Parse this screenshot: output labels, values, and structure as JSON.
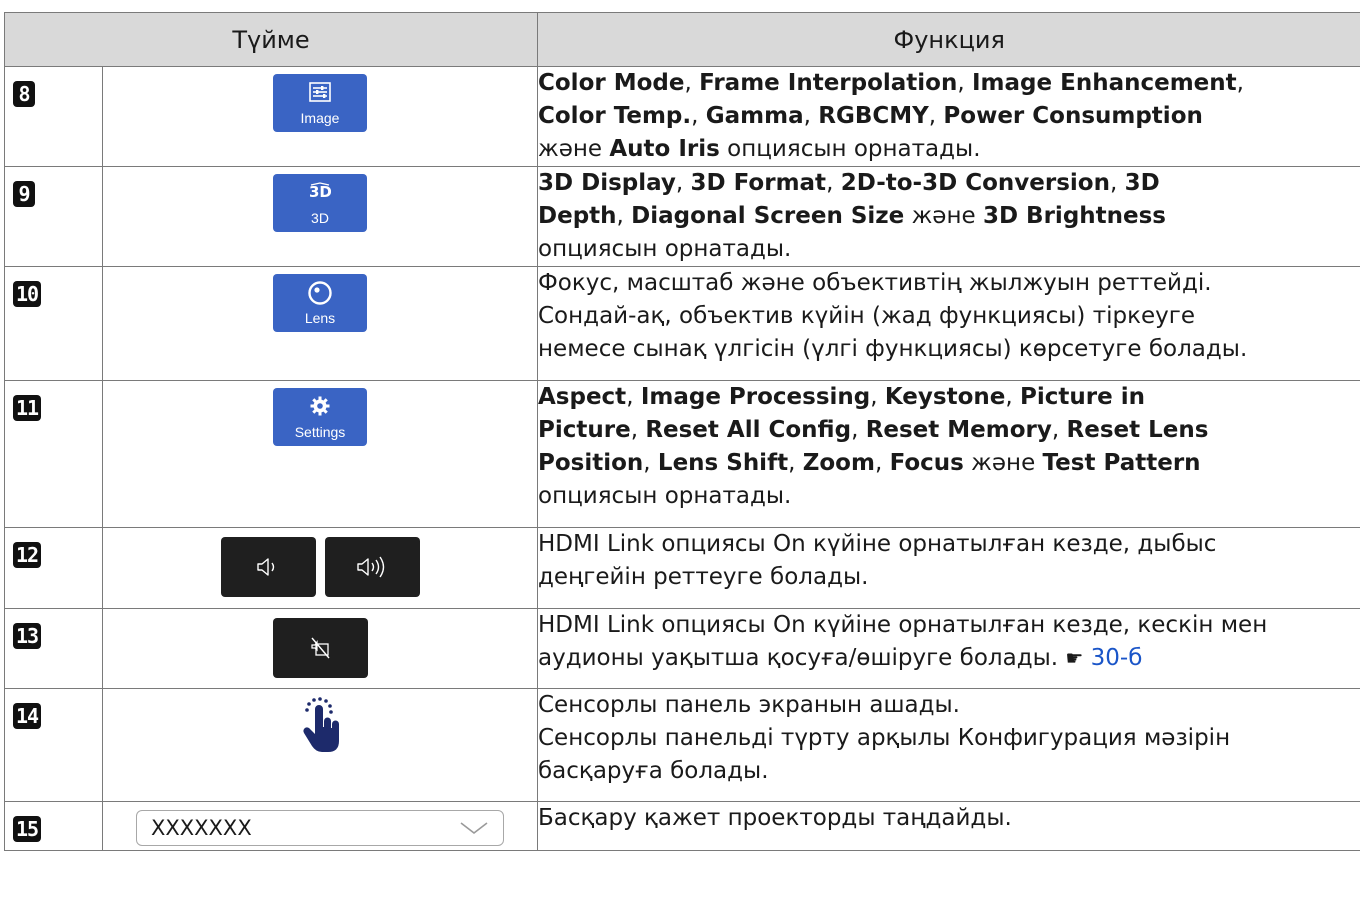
{
  "header": {
    "col_button": "Түйме",
    "col_function": "Функция"
  },
  "rows": [
    {
      "num": "8",
      "button": {
        "caption": "Image",
        "icon": "sliders-icon"
      },
      "lines": [
        [
          {
            "t": "Color Mode",
            "b": true
          },
          {
            "t": ", "
          },
          {
            "t": "Frame Interpolation",
            "b": true
          },
          {
            "t": ", "
          },
          {
            "t": "Image Enhancement",
            "b": true
          },
          {
            "t": ","
          }
        ],
        [
          {
            "t": "Color Temp.",
            "b": true
          },
          {
            "t": ", "
          },
          {
            "t": "Gamma",
            "b": true
          },
          {
            "t": ", "
          },
          {
            "t": "RGBCMY",
            "b": true
          },
          {
            "t": ", "
          },
          {
            "t": "Power Consumption",
            "b": true
          }
        ],
        [
          {
            "t": "және "
          },
          {
            "t": "Auto Iris",
            "b": true
          },
          {
            "t": " опциясын орнатады."
          }
        ]
      ]
    },
    {
      "num": "9",
      "button": {
        "caption": "3D",
        "icon": "3d-icon"
      },
      "lines": [
        [
          {
            "t": "3D Display",
            "b": true
          },
          {
            "t": ", "
          },
          {
            "t": "3D Format",
            "b": true
          },
          {
            "t": ", "
          },
          {
            "t": "2D-to-3D Conversion",
            "b": true
          },
          {
            "t": ", "
          },
          {
            "t": "3D",
            "b": true
          }
        ],
        [
          {
            "t": "Depth",
            "b": true
          },
          {
            "t": ", "
          },
          {
            "t": "Diagonal Screen Size",
            "b": true
          },
          {
            "t": " және "
          },
          {
            "t": "3D Brightness",
            "b": true
          }
        ],
        [
          {
            "t": "опциясын орнатады."
          }
        ]
      ]
    },
    {
      "num": "10",
      "button": {
        "caption": "Lens",
        "icon": "lens-icon"
      },
      "lines": [
        [
          {
            "t": "Фокус, масштаб және объективтің жылжуын реттейді."
          }
        ],
        [
          {
            "t": "Сондай-ақ, объектив күйін (жад функциясы) тіркеуге"
          }
        ],
        [
          {
            "t": "немесе сынақ үлгісін (үлгі функциясы) көрсетуге болады."
          }
        ]
      ]
    },
    {
      "num": "11",
      "button": {
        "caption": "Settings",
        "icon": "gear-icon"
      },
      "lines": [
        [
          {
            "t": "Aspect",
            "b": true
          },
          {
            "t": ", "
          },
          {
            "t": "Image Processing",
            "b": true
          },
          {
            "t": ", "
          },
          {
            "t": "Keystone",
            "b": true
          },
          {
            "t": ", "
          },
          {
            "t": "Picture in",
            "b": true
          }
        ],
        [
          {
            "t": "Picture",
            "b": true
          },
          {
            "t": ", "
          },
          {
            "t": "Reset All Config",
            "b": true
          },
          {
            "t": ", "
          },
          {
            "t": "Reset Memory",
            "b": true
          },
          {
            "t": ", "
          },
          {
            "t": "Reset Lens",
            "b": true
          }
        ],
        [
          {
            "t": "Position",
            "b": true
          },
          {
            "t": ", "
          },
          {
            "t": "Lens Shift",
            "b": true
          },
          {
            "t": ", "
          },
          {
            "t": "Zoom",
            "b": true
          },
          {
            "t": ", "
          },
          {
            "t": "Focus",
            "b": true
          },
          {
            "t": " және "
          },
          {
            "t": "Test Pattern",
            "b": true
          }
        ],
        [
          {
            "t": "опциясын орнатады."
          }
        ]
      ]
    },
    {
      "num": "12",
      "buttons": [
        {
          "icon": "volume-down-icon"
        },
        {
          "icon": "volume-up-icon"
        }
      ],
      "lines": [
        [
          {
            "t": "HDMI Link опциясы On күйіне орнатылған кезде, дыбыс"
          }
        ],
        [
          {
            "t": "деңгейін реттеуге болады."
          }
        ]
      ]
    },
    {
      "num": "13",
      "buttons": [
        {
          "icon": "av-mute-icon"
        }
      ],
      "lines": [
        [
          {
            "t": "HDMI Link опциясы On күйіне орнатылған кезде, кескін мен"
          }
        ],
        [
          {
            "t": "аудионы уақытша қосуға/өшіруге болады. "
          },
          {
            "t": "☛",
            "pointer": true
          },
          {
            "t": " "
          },
          {
            "t": "30-б",
            "link": true
          }
        ]
      ]
    },
    {
      "num": "14",
      "icon": "touch-hand-icon",
      "lines": [
        [
          {
            "t": "Сенсорлы панель экранын ашады."
          }
        ],
        [
          {
            "t": "Сенсорлы панельді түрту арқылы Конфигурация мәзірін"
          }
        ],
        [
          {
            "t": "басқаруға болады."
          }
        ]
      ]
    },
    {
      "num": "15",
      "select": {
        "value": "XXXXXXX",
        "icon": "chevron-down-icon"
      },
      "lines": [
        [
          {
            "t": "Басқару қажет проекторды таңдайды."
          }
        ]
      ]
    }
  ],
  "colors": {
    "button_blue": "#3a64c4",
    "button_dark": "#1f1f1f",
    "hand_navy": "#1d2a6b",
    "link": "#1a55c8",
    "header_bg": "#d9d9d9"
  }
}
